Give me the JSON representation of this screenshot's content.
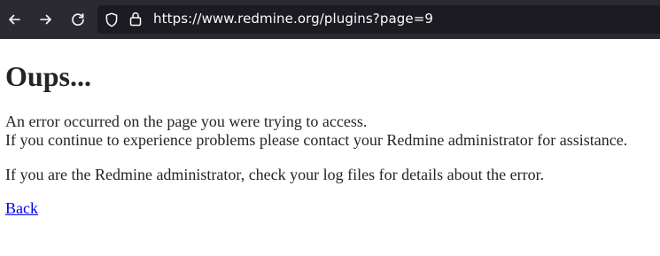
{
  "browser": {
    "url": "https://www.redmine.org/plugins?page=9",
    "icons": [
      "back-arrow-icon",
      "forward-arrow-icon",
      "reload-icon",
      "shield-icon",
      "lock-icon"
    ],
    "colors": {
      "toolbar": "#2b2a33",
      "urlbar": "#1c1b22",
      "icon": "#fbfbfe"
    }
  },
  "page": {
    "title": "Oups...",
    "message_line1": "An error occurred on the page you were trying to access.",
    "message_line2": "If you continue to experience problems please contact your Redmine administrator for assistance.",
    "message_admin": "If you are the Redmine administrator, check your log files for details about the error.",
    "back_link": "Back",
    "colors": {
      "text": "#242424",
      "link": "#0000ee"
    }
  }
}
